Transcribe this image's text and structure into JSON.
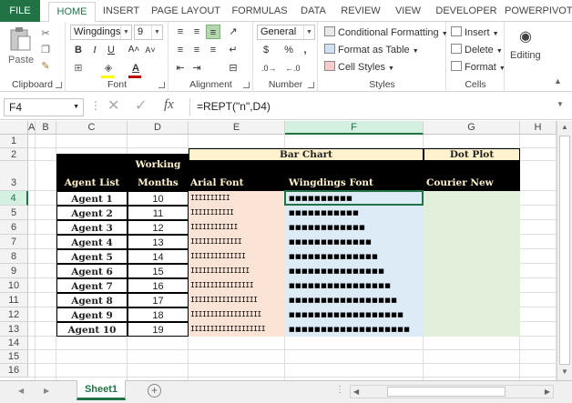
{
  "tabs": [
    "FILE",
    "HOME",
    "INSERT",
    "PAGE LAYOUT",
    "FORMULAS",
    "DATA",
    "REVIEW",
    "VIEW",
    "DEVELOPER",
    "POWERPIVOT"
  ],
  "active_tab": "HOME",
  "ribbon": {
    "clipboard": {
      "paste_label": "Paste",
      "group_label": "Clipboard"
    },
    "font": {
      "font_name": "Wingdings",
      "font_size": "9",
      "group_label": "Font",
      "bold": "B",
      "italic": "I",
      "underline": "U",
      "grow": "A˄",
      "shrink": "A˅"
    },
    "alignment": {
      "group_label": "Alignment"
    },
    "number": {
      "format": "General",
      "group_label": "Number",
      "currency": "$",
      "percent": "%",
      "comma": ","
    },
    "styles": {
      "conditional_formatting": "Conditional Formatting",
      "format_as_table": "Format as Table",
      "cell_styles": "Cell Styles",
      "group_label": "Styles"
    },
    "cells": {
      "insert": "Insert",
      "delete": "Delete",
      "format": "Format",
      "group_label": "Cells"
    },
    "editing": {
      "label": "Editing"
    }
  },
  "formula_bar": {
    "name_box": "F4",
    "formula": "=REPT(\"n\",D4)",
    "fx": "fx"
  },
  "columns": [
    "A",
    "B",
    "C",
    "D",
    "E",
    "F",
    "G",
    "H"
  ],
  "rows": [
    "1",
    "2",
    "3",
    "4",
    "5",
    "6",
    "7",
    "8",
    "9",
    "10",
    "11",
    "12",
    "13",
    "14",
    "15",
    "16"
  ],
  "sheet": {
    "bar_chart_header": "Bar Chart",
    "dot_plot_header": "Dot Plot",
    "col_agent_list": "Agent List",
    "col_working": "Working",
    "col_months": "Months",
    "col_arial": "Arial Font",
    "col_wingdings": "Wingdings Font",
    "col_courier": "Courier New",
    "agents": [
      {
        "name": "Agent 1",
        "months": 10
      },
      {
        "name": "Agent 2",
        "months": 11
      },
      {
        "name": "Agent 3",
        "months": 12
      },
      {
        "name": "Agent 4",
        "months": 13
      },
      {
        "name": "Agent 5",
        "months": 14
      },
      {
        "name": "Agent 6",
        "months": 15
      },
      {
        "name": "Agent 7",
        "months": 16
      },
      {
        "name": "Agent 8",
        "months": 17
      },
      {
        "name": "Agent 9",
        "months": 18
      },
      {
        "name": "Agent 10",
        "months": 19
      }
    ]
  },
  "sheet_tabs": [
    "Sheet1"
  ],
  "colors": {
    "accent": "#217346",
    "header_fill": "#fff2cc",
    "arial_fill": "#fbe4d6",
    "wingdings_fill": "#ddebf7",
    "courier_fill": "#e2efda"
  }
}
